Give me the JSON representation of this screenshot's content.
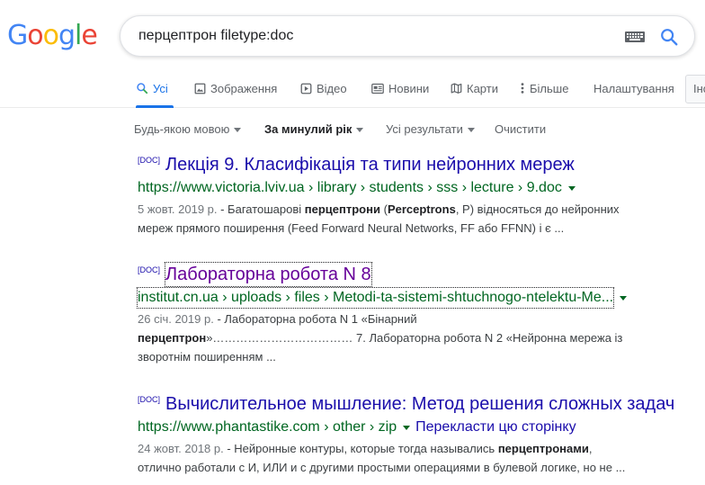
{
  "logo": {
    "letters": [
      "G",
      "o",
      "o",
      "g",
      "l",
      "e"
    ],
    "colors": [
      "#4285F4",
      "#EA4335",
      "#FBBC05",
      "#4285F4",
      "#34A853",
      "#EA4335"
    ]
  },
  "search": {
    "query": "перцептрон filetype:doc"
  },
  "tabs": {
    "all": "Усі",
    "images": "Зображення",
    "videos": "Відео",
    "news": "Новини",
    "maps": "Карти",
    "more": "Більше",
    "settings": "Налаштування",
    "tools": "Інструменти"
  },
  "filters": {
    "language": "Будь-якою мовою",
    "time": "За минулий рік",
    "results": "Усі результати",
    "clear": "Очистити"
  },
  "results": [
    {
      "badge": "[DOC]",
      "title": "Лекція 9. Класифікація та типи нейронних мереж",
      "url": "https://www.victoria.lviv.ua › library › students › sss › lecture › 9.doc",
      "date": "5 жовт. 2019 р.",
      "snippet_1a": " - Багатошарові ",
      "snippet_1b": "перцептрони",
      "snippet_1c": " (",
      "snippet_1d": "Perceptrons",
      "snippet_1e": ", P) відносяться до нейронних",
      "snippet_2": "мереж прямого поширення (Feed Forward Neural Networks, FF або FFNN) і є ..."
    },
    {
      "badge": "[DOC]",
      "title": "Лабораторна робота N 8",
      "url": "institut.cn.ua › uploads › files › Metodi-ta-sistemi-shtuchnogo-ntelektu-Me...",
      "date": "26 січ. 2019 р.",
      "snippet_1": " - Лабораторна робота N 1 «Бінарний",
      "snippet_2a": "перцептрон",
      "snippet_2b": "»……………………………… 7. Лабораторна робота N 2 «Нейронна мережа із",
      "snippet_3": "зворотнім поширенням ..."
    },
    {
      "badge": "[DOC]",
      "title": "Вычислительное мышление: Метод решения сложных задач",
      "url": "https://www.phantastike.com › other › zip",
      "translate": "Перекласти цю сторінку",
      "date": "24 жовт. 2018 р.",
      "snippet_1a": " - Нейронные контуры, которые тогда назывались ",
      "snippet_1b": "перцептронами",
      "snippet_1c": ",",
      "snippet_2": "отлично работали с И, ИЛИ и с другими простыми операциями в булевой логике, но не ..."
    }
  ]
}
